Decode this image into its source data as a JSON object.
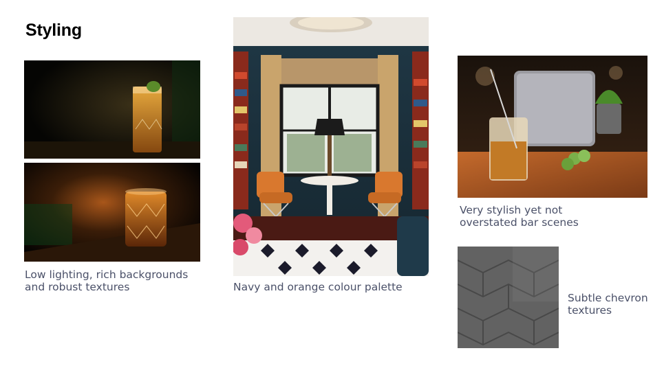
{
  "slide": {
    "title": "Styling"
  },
  "panels": [
    {
      "images": [
        "cocktail-highball-icon",
        "cocktail-rocks-glass-icon"
      ],
      "caption_line1": "Low lighting, rich backgrounds",
      "caption_line2": "and robust textures"
    },
    {
      "images": [
        "navy-orange-interior-icon"
      ],
      "caption_line1": "Navy and orange colour palette"
    },
    {
      "images": [
        "bar-scene-icon"
      ],
      "caption_line1": "Very stylish yet not",
      "caption_line2": "overstated bar scenes"
    },
    {
      "images": [
        "chevron-texture-icon"
      ],
      "caption_line1": "Subtle chevron",
      "caption_line2": "textures"
    }
  ],
  "colors": {
    "caption": "#4a5068",
    "navy": "#1f3a4a",
    "orange": "#d9782e"
  }
}
